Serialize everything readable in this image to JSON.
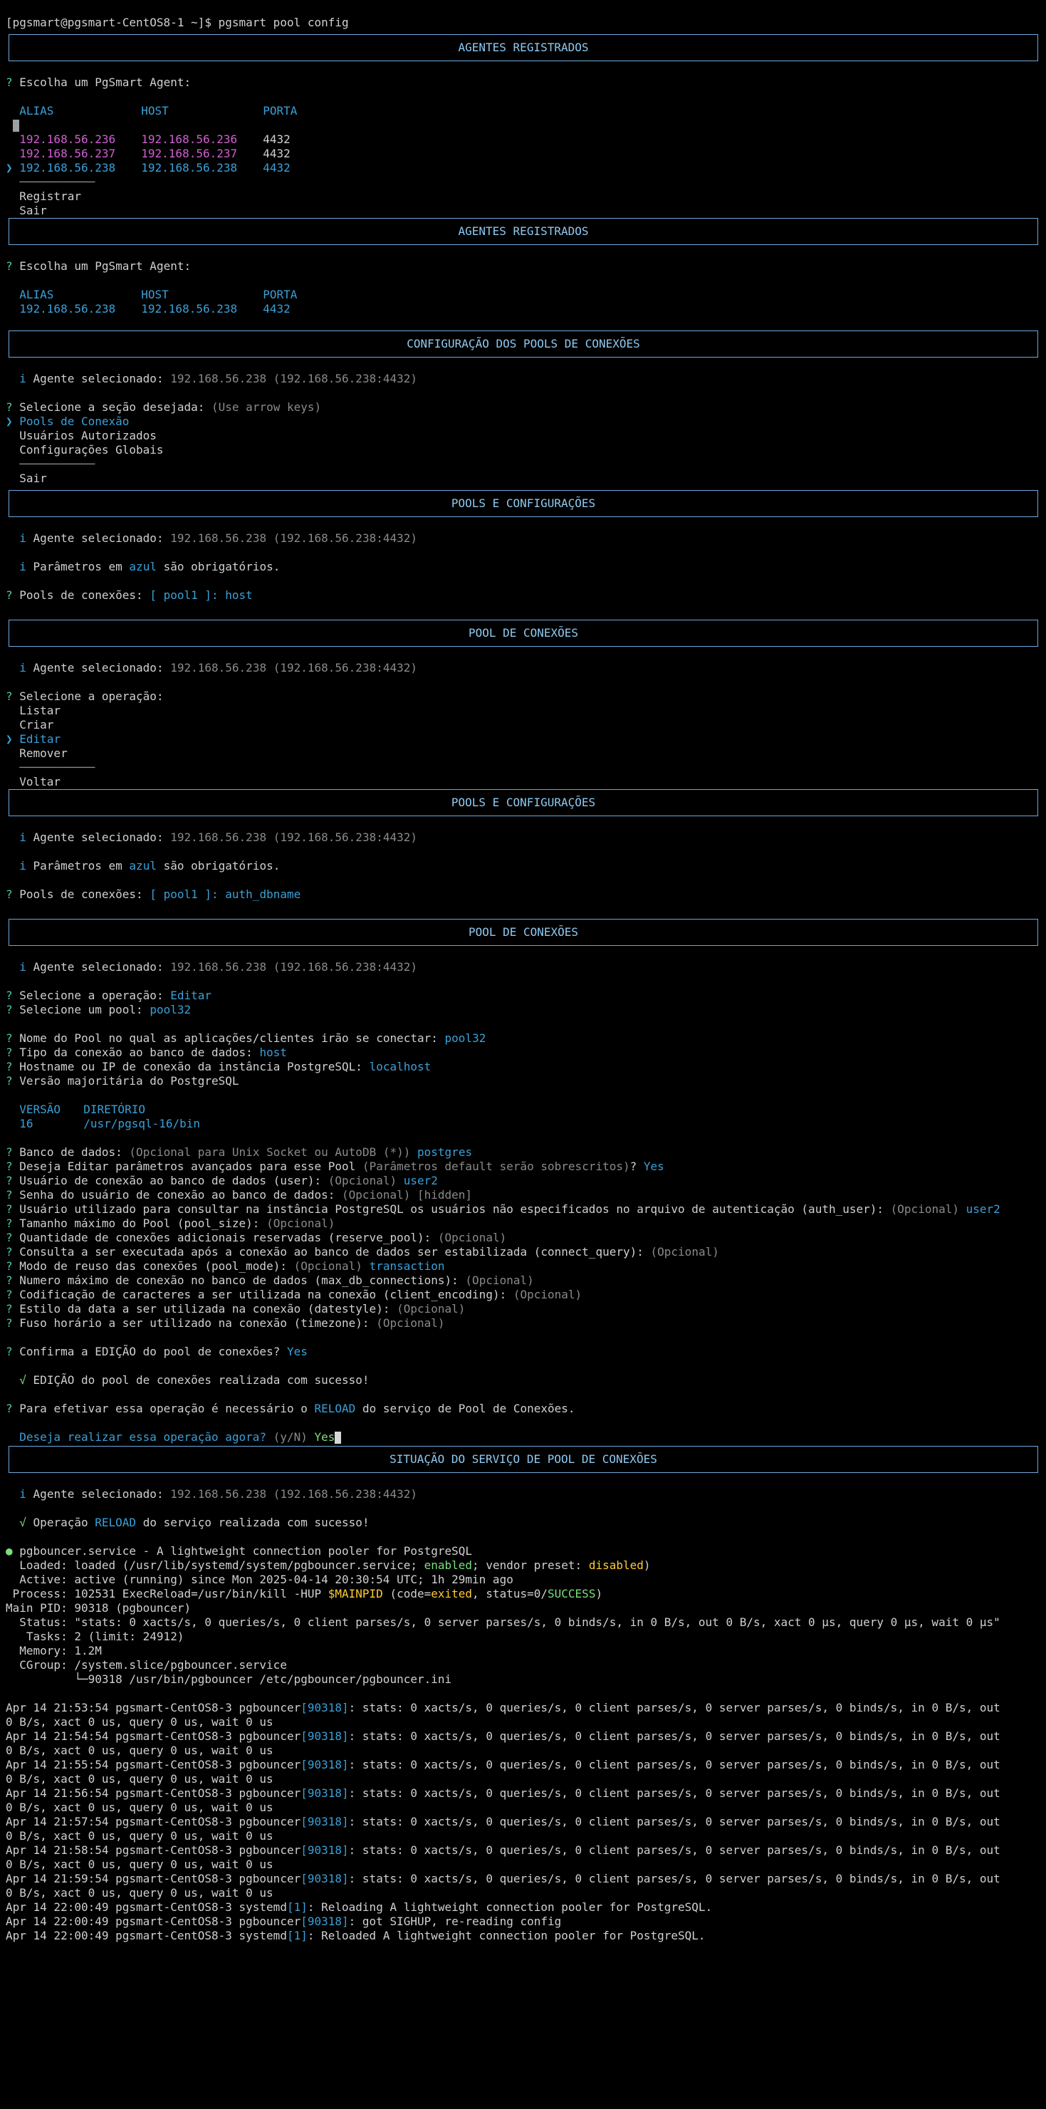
{
  "prompt": "[pgsmart@pgsmart-CentOS8-1 ~]$ pgsmart pool config",
  "agents1": {
    "title": "AGENTES REGISTRADOS",
    "question": "Escolha um PgSmart Agent:",
    "headers": [
      "ALIAS",
      "HOST",
      "PORTA"
    ],
    "rows": [
      {
        "alias": "192.168.56.236",
        "host": "192.168.56.236",
        "port": "4432"
      },
      {
        "alias": "192.168.56.237",
        "host": "192.168.56.237",
        "port": "4432"
      },
      {
        "alias": "192.168.56.238",
        "host": "192.168.56.238",
        "port": "4432"
      }
    ],
    "separator": "───────────",
    "actions": [
      "Registrar",
      "Sair"
    ]
  },
  "agents2": {
    "title": "AGENTES REGISTRADOS",
    "question": "Escolha um PgSmart Agent:",
    "headers": [
      "ALIAS",
      "HOST",
      "PORTA"
    ],
    "row": {
      "alias": "192.168.56.238",
      "host": "192.168.56.238",
      "port": "4432"
    }
  },
  "config": {
    "title": "CONFIGURAÇÃO DOS POOLS DE CONEXÕES",
    "agent_label": "Agente selecionado:",
    "agent_value": "192.168.56.238 (192.168.56.238:4432)",
    "question": "Selecione a seção desejada:",
    "hint": "(Use arrow keys)",
    "options": [
      "Pools de Conexão",
      "Usuários Autorizados",
      "Configurações Globais"
    ],
    "exit": "Sair"
  },
  "pools1": {
    "title": "POOLS E CONFIGURAÇÕES",
    "agent_label": "Agente selecionado:",
    "agent_value": "192.168.56.238 (192.168.56.238:4432)",
    "params_pre": "Parâmetros em",
    "params_blue": "azul",
    "params_post": "são obrigatórios.",
    "pools_label": "Pools de conexões:",
    "pools_value": "[ pool1 ]: host"
  },
  "pool_ops1": {
    "title": "POOL DE CONEXÕES",
    "agent_label": "Agente selecionado:",
    "agent_value": "192.168.56.238 (192.168.56.238:4432)",
    "question": "Selecione a operação:",
    "options": [
      "Listar",
      "Criar",
      "Editar",
      "Remover"
    ],
    "back": "Voltar"
  },
  "pools2": {
    "title": "POOLS E CONFIGURAÇÕES",
    "agent_label": "Agente selecionado:",
    "agent_value": "192.168.56.238 (192.168.56.238:4432)",
    "params_pre": "Parâmetros em",
    "params_blue": "azul",
    "params_post": "são obrigatórios.",
    "pools_label": "Pools de conexões:",
    "pools_value": "[ pool1 ]: auth_dbname"
  },
  "pool_edit": {
    "title": "POOL DE CONEXÕES",
    "agent_label": "Agente selecionado:",
    "agent_value": "192.168.56.238 (192.168.56.238:4432)",
    "op_label": "Selecione a operação:",
    "op_value": "Editar",
    "pool_label": "Selecione um pool:",
    "pool_value": "pool32",
    "name_label": "Nome do Pool no qual as aplicações/clientes irão se conectar:",
    "name_value": "pool32",
    "type_label": "Tipo da conexão ao banco de dados:",
    "type_value": "host",
    "hostname_label": "Hostname ou IP de conexão da instância PostgreSQL:",
    "hostname_value": "localhost",
    "version_label": "Versão majoritária do PostgreSQL",
    "version_headers": [
      "VERSÃO",
      "DIRETÓRIO"
    ],
    "version_row": [
      "16",
      "/usr/pgsql-16/bin"
    ],
    "db_label": "Banco de dados:",
    "db_hint": "(Opcional para Unix Socket ou AutoDB (*))",
    "db_value": "postgres",
    "adv_label": "Deseja Editar parâmetros avançados para esse Pool",
    "adv_hint": "(Parâmetros default serão sobrescritos)",
    "adv_q": "?",
    "adv_value": "Yes",
    "user_label": "Usuário de conexão ao banco de dados (user):",
    "user_value": "user2",
    "pass_label": "Senha do usuário de conexão ao banco de dados:",
    "pass_value": "[hidden]",
    "auth_label": "Usuário utilizado para consultar na instância PostgreSQL os usuários não especificados no arquivo de autenticação (auth_user):",
    "auth_value": "user2",
    "opcional": "(Opcional)",
    "optional_fields": [
      "Tamanho máximo do Pool (pool_size):",
      "Quantidade de conexões adicionais reservadas (reserve_pool):",
      "Consulta a ser executada após a conexão ao banco de dados ser estabilizada (connect_query):"
    ],
    "poolmode_label": "Modo de reuso das conexões (pool_mode):",
    "poolmode_value": "transaction",
    "optional_fields2": [
      "Numero máximo de conexão no banco de dados (max_db_connections):",
      "Codificação de caracteres a ser utilizada na conexão (client_encoding):",
      "Estilo da data a ser utilizada na conexão (datestyle):",
      "Fuso horário a ser utilizado na conexão (timezone):"
    ],
    "confirm_label": "Confirma a EDIÇÃO do pool de conexões?",
    "confirm_value": "Yes",
    "success": "EDIÇÃO do pool de conexões realizada com sucesso!",
    "reload_pre": "Para efetivar essa operação é necessário o",
    "reload_word": "RELOAD",
    "reload_post": "do serviço de Pool de Conexões.",
    "now_label": "Deseja realizar essa operação agora?",
    "now_hint": "(y/N)",
    "now_value": "Yes"
  },
  "status": {
    "title": "SITUAÇÃO DO SERVIÇO DE POOL DE CONEXÕES",
    "agent_label": "Agente selecionado:",
    "agent_value": "192.168.56.238 (192.168.56.238:4432)",
    "op_pre": "Operação",
    "op_word": "RELOAD",
    "op_post": "do serviço realizada com sucesso!",
    "service_line": "pgbouncer.service - A lightweight connection pooler for PostgreSQL",
    "loaded_pre": "  Loaded: loaded (/usr/lib/systemd/system/pgbouncer.service; ",
    "loaded_enabled": "enabled",
    "loaded_mid": "; vendor preset: ",
    "loaded_disabled": "disabled",
    "loaded_post": ")",
    "active_line": "  Active: active (running) since Mon 2025-04-14 20:30:54 UTC; 1h 29min ago",
    "process_pre": " Process: 102531 ExecReload=/usr/bin/kill -HUP ",
    "process_var": "$MAINPID",
    "process_mid": " (code=",
    "process_exited": "exited",
    "process_mid2": ", status=0/",
    "process_success": "SUCCESS",
    "process_post": ")",
    "mainpid": "Main PID: 90318 (pgbouncer)",
    "status_line": "  Status: \"stats: 0 xacts/s, 0 queries/s, 0 client parses/s, 0 server parses/s, 0 binds/s, in 0 B/s, out 0 B/s, xact 0 µs, query 0 µs, wait 0 µs\"",
    "tasks": "   Tasks: 2 (limit: 24912)",
    "memory": "  Memory: 1.2M",
    "cgroup": "  CGroup: /system.slice/pgbouncer.service",
    "cgroup_child": "          └─90318 /usr/bin/pgbouncer /etc/pgbouncer/pgbouncer.ini"
  },
  "logs": [
    {
      "pre": "Apr 14 21:53:54 pgsmart-CentOS8-3 pgbouncer",
      "pid": "[90318]",
      "post": ": stats: 0 xacts/s, 0 queries/s, 0 client parses/s, 0 server parses/s, 0 binds/s, in 0 B/s, out",
      "cont": "0 B/s, xact 0 us, query 0 us, wait 0 us"
    },
    {
      "pre": "Apr 14 21:54:54 pgsmart-CentOS8-3 pgbouncer",
      "pid": "[90318]",
      "post": ": stats: 0 xacts/s, 0 queries/s, 0 client parses/s, 0 server parses/s, 0 binds/s, in 0 B/s, out",
      "cont": "0 B/s, xact 0 us, query 0 us, wait 0 us"
    },
    {
      "pre": "Apr 14 21:55:54 pgsmart-CentOS8-3 pgbouncer",
      "pid": "[90318]",
      "post": ": stats: 0 xacts/s, 0 queries/s, 0 client parses/s, 0 server parses/s, 0 binds/s, in 0 B/s, out",
      "cont": "0 B/s, xact 0 us, query 0 us, wait 0 us"
    },
    {
      "pre": "Apr 14 21:56:54 pgsmart-CentOS8-3 pgbouncer",
      "pid": "[90318]",
      "post": ": stats: 0 xacts/s, 0 queries/s, 0 client parses/s, 0 server parses/s, 0 binds/s, in 0 B/s, out",
      "cont": "0 B/s, xact 0 us, query 0 us, wait 0 us"
    },
    {
      "pre": "Apr 14 21:57:54 pgsmart-CentOS8-3 pgbouncer",
      "pid": "[90318]",
      "post": ": stats: 0 xacts/s, 0 queries/s, 0 client parses/s, 0 server parses/s, 0 binds/s, in 0 B/s, out",
      "cont": "0 B/s, xact 0 us, query 0 us, wait 0 us"
    },
    {
      "pre": "Apr 14 21:58:54 pgsmart-CentOS8-3 pgbouncer",
      "pid": "[90318]",
      "post": ": stats: 0 xacts/s, 0 queries/s, 0 client parses/s, 0 server parses/s, 0 binds/s, in 0 B/s, out",
      "cont": "0 B/s, xact 0 us, query 0 us, wait 0 us"
    },
    {
      "pre": "Apr 14 21:59:54 pgsmart-CentOS8-3 pgbouncer",
      "pid": "[90318]",
      "post": ": stats: 0 xacts/s, 0 queries/s, 0 client parses/s, 0 server parses/s, 0 binds/s, in 0 B/s, out",
      "cont": "0 B/s, xact 0 us, query 0 us, wait 0 us"
    }
  ],
  "final_logs": [
    {
      "pre": "Apr 14 22:00:49 pgsmart-CentOS8-3 systemd",
      "pid": "[1]",
      "post": ": Reloading A lightweight connection pooler for PostgreSQL."
    },
    {
      "pre": "Apr 14 22:00:49 pgsmart-CentOS8-3 pgbouncer",
      "pid": "[90318]",
      "post": ": got SIGHUP, re-reading config"
    },
    {
      "pre": "Apr 14 22:00:49 pgsmart-CentOS8-3 systemd",
      "pid": "[1]",
      "post": ": Reloaded A lightweight connection pooler for PostgreSQL."
    }
  ],
  "colors": {
    "background": "#000000",
    "text": "#d0d0d0",
    "question_mark": "#4ec9b0",
    "cyan": "#3aa0d8",
    "magenta": "#d15fd1",
    "gray": "#8a8a8a",
    "green": "#7be07b",
    "box_border": "#6fa8dc"
  }
}
